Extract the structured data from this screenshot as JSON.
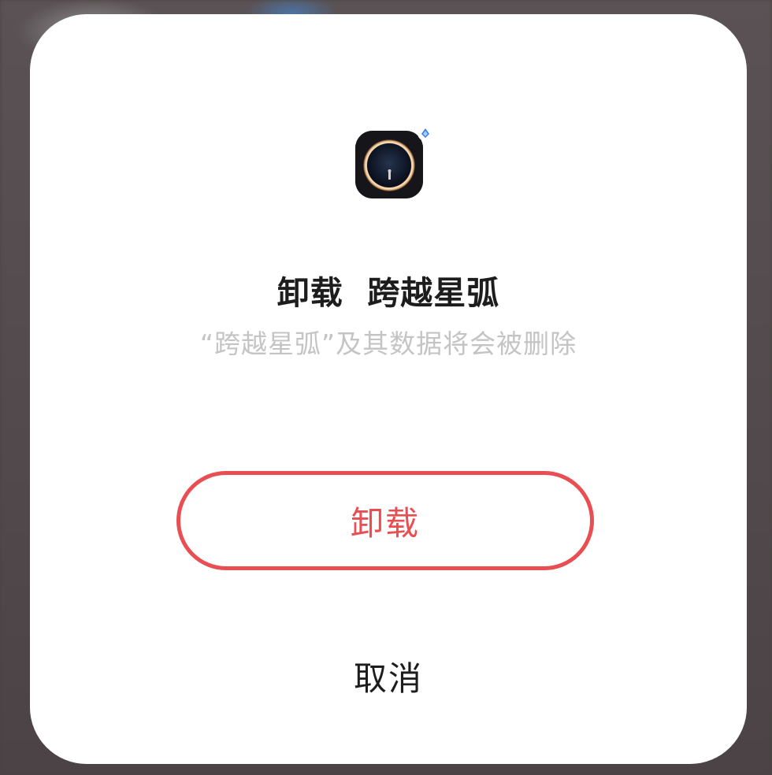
{
  "dialog": {
    "title": "卸载  跨越星弧",
    "message": "“跨越星弧”及其数据将会被删除",
    "confirm_label": "卸载",
    "cancel_label": "取消",
    "app_icon": "app-icon-planet-ring"
  },
  "colors": {
    "accent": "#e84e52",
    "title_text": "#1d1d1d",
    "secondary_text": "#c4c4c4",
    "dialog_background": "#ffffff",
    "backdrop": "#4a4244"
  }
}
